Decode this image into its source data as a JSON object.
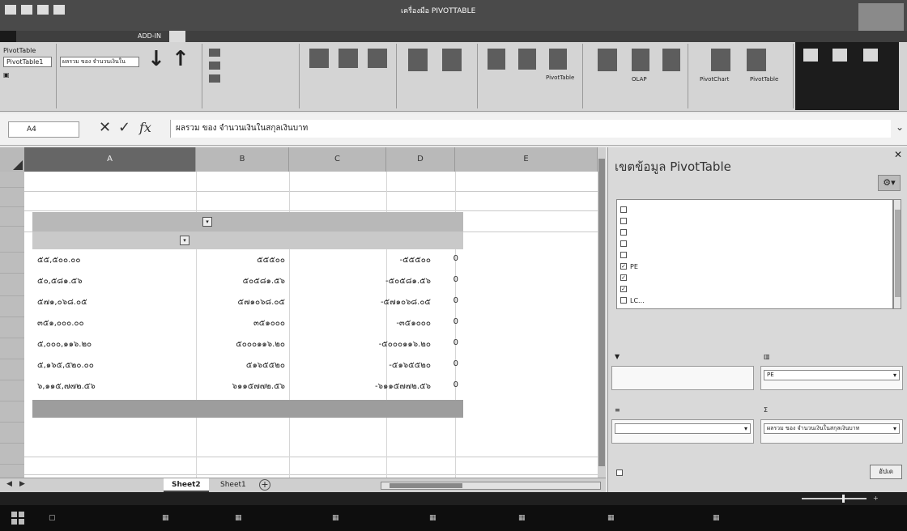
{
  "title_bar": {
    "context_label": "เครื่องมือ PIVOTTABLE"
  },
  "ribbon_tabs": [
    {
      "label": "",
      "file": true
    },
    {
      "label": ""
    },
    {
      "label": ""
    },
    {
      "label": ""
    },
    {
      "label": ""
    },
    {
      "label": ""
    },
    {
      "label": ""
    },
    {
      "label": ""
    },
    {
      "label": "ADD-IN"
    },
    {
      "label": "",
      "active": true
    },
    {
      "label": ""
    }
  ],
  "ribbon": {
    "pivottable_label": "PivotTable",
    "pivottable_name": "PivotTable1",
    "active_field_value": "ผลรวม ของ จำนวนเงินใน",
    "cmd_pivotchart": "PivotChart",
    "cmd_pivottable_recommended": "PivotTable",
    "cmd_olap": "OLAP",
    "cmd_move_pivottable": "PivotTable"
  },
  "formula_bar": {
    "name_box": "A4",
    "formula": "ผลรวม ของ จำนวนเงินในสกุลเงินบาท"
  },
  "sheet": {
    "column_headers": [
      "A",
      "B",
      "C",
      "D",
      "E"
    ],
    "row_headers": [
      "",
      "",
      "",
      "",
      "",
      "",
      "",
      "",
      "",
      "",
      "",
      "",
      "",
      "",
      "",
      "",
      "",
      ""
    ],
    "pivot": {
      "rows": [
        {
          "label": "๕๕,๕๐๐.๐๐",
          "value": "๕๕๕๐๐",
          "diff": "-๕๕๕๐๐",
          "zero": "0"
        },
        {
          "label": "๕๐,๕๘๑.๕๖",
          "value": "๕๐๕๘๑.๕๖",
          "diff": "-๕๐๕๘๑.๕๖",
          "zero": "0"
        },
        {
          "label": "๕๗๑,๐๖๘.๐๕",
          "value": "๕๗๑๐๖๘.๐๕",
          "diff": "-๕๗๑๐๖๘.๐๕",
          "zero": "0"
        },
        {
          "label": "๓๕๑,๐๐๐.๐๐",
          "value": "๓๕๑๐๐๐",
          "diff": "-๓๕๑๐๐๐",
          "zero": "0"
        },
        {
          "label": "๕,๐๐๐,๑๑๖.๒๐",
          "value": "๕๐๐๐๑๑๖.๒๐",
          "diff": "-๕๐๐๐๑๑๖.๒๐",
          "zero": "0"
        },
        {
          "label": "๕,๑๖๕,๕๒๐.๐๐",
          "value": "๕๑๖๕๕๒๐",
          "diff": "-๕๑๖๕๕๒๐",
          "zero": "0"
        },
        {
          "label": "๖,๑๑๕,๗๗๒.๕๖",
          "value": "๖๑๑๕๗๗๒.๕๖",
          "diff": "-๖๑๑๕๗๗๒.๕๖",
          "zero": "0"
        }
      ]
    }
  },
  "sheet_tabs": [
    "Sheet2",
    "Sheet1"
  ],
  "pane": {
    "title": "เขตข้อมูล PivotTable",
    "fields": [
      {
        "label": "",
        "checked": false
      },
      {
        "label": "",
        "checked": false
      },
      {
        "label": "",
        "checked": false
      },
      {
        "label": "",
        "checked": false
      },
      {
        "label": "",
        "checked": false
      },
      {
        "label": "PE",
        "checked": true
      },
      {
        "label": "",
        "checked": true
      },
      {
        "label": "",
        "checked": true
      },
      {
        "label": "LC...",
        "checked": false
      }
    ],
    "areas": {
      "columns_chip": "PE",
      "values_chip": "ผลรวม ของ จำนวนเงินในสกุลเงินบาท"
    },
    "update_button": "อัปเด"
  },
  "status_bar": {
    "mode": ""
  }
}
